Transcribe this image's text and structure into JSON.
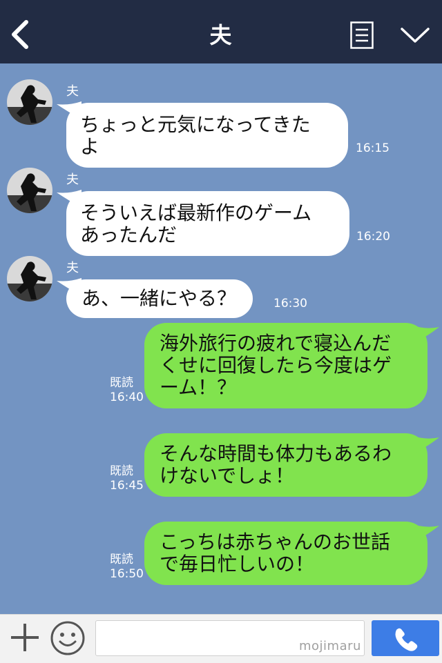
{
  "header": {
    "title": "夫"
  },
  "messages": [
    {
      "sender": "夫",
      "text": "ちょっと元気になってきた\nよ",
      "time": "16:15"
    },
    {
      "sender": "夫",
      "text": "そういえば最新作のゲーム\nあったんだ",
      "time": "16:20"
    },
    {
      "sender": "夫",
      "text": "あ、一緒にやる？",
      "time": "16:30"
    },
    {
      "text": "海外旅行の疲れで寝込んだ\nくせに回復したら今度はゲ\nーム！？",
      "read": "既読\n16:40"
    },
    {
      "text": "そんな時間も体力もあるわ\nけないでしょ！",
      "read": "既読\n16:45"
    },
    {
      "text": "こっちは赤ちゃんのお世話\nで毎日忙しいの！",
      "read": "既読\n16:50"
    }
  ],
  "footer": {
    "input_value": "",
    "watermark": "mojimaru"
  },
  "colors": {
    "header_bg": "#222c44",
    "chat_bg": "#7394c2",
    "outgoing": "#81e34e",
    "incoming": "#ffffff",
    "call_button": "#3d7de6"
  },
  "icons": {
    "back": "chevron-left-icon",
    "menu": "notes-icon",
    "collapse": "chevron-down-icon",
    "add": "plus-icon",
    "emoji": "smiley-icon",
    "call": "phone-icon"
  }
}
